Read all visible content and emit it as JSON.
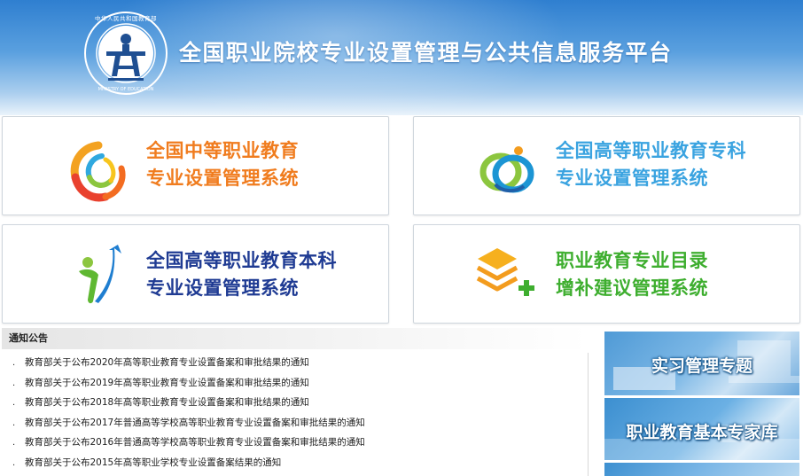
{
  "header": {
    "title": "全国职业院校专业设置管理与公共信息服务平台",
    "emblem_text": "中华人民共和国教育部",
    "emblem_text_en": "MINISTRY OF EDUCATION"
  },
  "cards": [
    {
      "line1": "全国中等职业教育",
      "line2": "专业设置管理系统",
      "color": "#f07c1e"
    },
    {
      "line1": "全国高等职业教育专科",
      "line2": "专业设置管理系统",
      "color": "#3aa3e0"
    },
    {
      "line1": "全国高等职业教育本科",
      "line2": "专业设置管理系统",
      "color": "#1f3b93"
    },
    {
      "line1": "职业教育专业目录",
      "line2": "增补建议管理系统",
      "color": "#3eae2f"
    }
  ],
  "notice": {
    "title": "通知公告",
    "items": [
      "教育部关于公布2020年高等职业教育专业设置备案和审批结果的通知",
      "教育部关于公布2019年高等职业教育专业设置备案和审批结果的通知",
      "教育部关于公布2018年高等职业教育专业设置备案和审批结果的通知",
      "教育部关于公布2017年普通高等学校高等职业教育专业设置备案和审批结果的通知",
      "教育部关于公布2016年普通高等学校高等职业教育专业设置备案和审批结果的通知",
      "教育部关于公布2015年高等职业学校专业设置备案结果的通知"
    ]
  },
  "side_banners": [
    {
      "label": "实习管理专题"
    },
    {
      "label": "职业教育基本专家库"
    }
  ]
}
